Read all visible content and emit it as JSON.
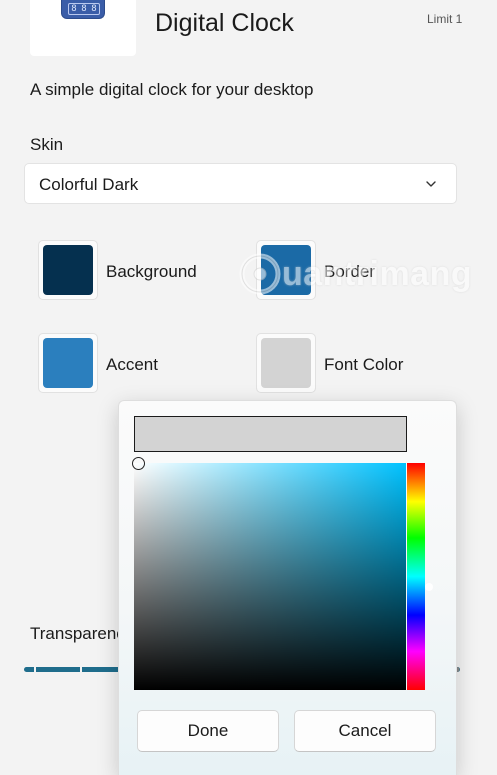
{
  "header": {
    "title": "Digital Clock",
    "limit": "Limit 1",
    "description": "A simple digital clock for your desktop",
    "icon_digits": [
      "8",
      "8",
      "8"
    ]
  },
  "skin": {
    "label": "Skin",
    "selected": "Colorful Dark",
    "chevron_icon": "chevron-down-icon"
  },
  "colors": {
    "background": {
      "label": "Background",
      "value": "#05304f"
    },
    "border": {
      "label": "Border",
      "value": "#1b6aa6"
    },
    "accent": {
      "label": "Accent",
      "value": "#2b7fbe"
    },
    "font_color": {
      "label": "Font Color",
      "value": "#d3d3d3"
    }
  },
  "watermark": {
    "text": "uantrimang"
  },
  "transparency": {
    "label": "Transparency",
    "value_fraction": 1.0
  },
  "color_picker": {
    "current_color": "#d3d3d3",
    "base_hue_color": "#00c2ff",
    "done_label": "Done",
    "cancel_label": "Cancel"
  }
}
